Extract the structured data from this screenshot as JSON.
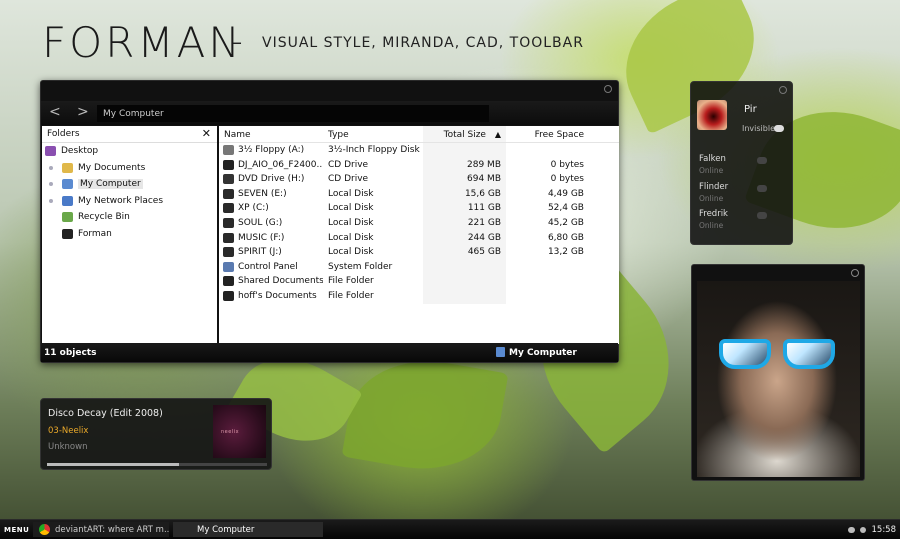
{
  "header": {
    "title": "FORMAN",
    "dash": "–",
    "subtitle": "VISUAL STYLE, MIRANDA, CAD, TOOLBAR"
  },
  "explorer": {
    "back_icon": "<",
    "forward_icon": ">",
    "address": "My Computer",
    "folders_title": "Folders",
    "close_glyph": "✕",
    "tree": [
      {
        "label": "Desktop",
        "icon": "desktop-icon",
        "color": "#8a4fb0"
      },
      {
        "label": "My Documents",
        "icon": "folder-documents-icon",
        "color": "#e0b84a"
      },
      {
        "label": "My Computer",
        "icon": "computer-icon",
        "color": "#5a8ad0"
      },
      {
        "label": "My Network Places",
        "icon": "network-icon",
        "color": "#4a7ac8"
      },
      {
        "label": "Recycle Bin",
        "icon": "recycle-bin-icon",
        "color": "#6aa84a"
      },
      {
        "label": "Forman",
        "icon": "folder-icon",
        "color": "#222222"
      }
    ],
    "columns": {
      "name": "Name",
      "type": "Type",
      "size": "Total Size",
      "free": "Free Space",
      "sort_glyph": "▲"
    },
    "files": [
      {
        "name": "3½ Floppy (A:)",
        "type": "3½-Inch Floppy Disk",
        "size": "",
        "free": "",
        "icon": "floppy-icon",
        "color": "#777777"
      },
      {
        "name": "DJ_AIO_06_F2400...",
        "type": "CD Drive",
        "size": "289 MB",
        "free": "0 bytes",
        "icon": "hp-cd-icon",
        "color": "#222222"
      },
      {
        "name": "DVD Drive (H:)",
        "type": "CD Drive",
        "size": "694 MB",
        "free": "0 bytes",
        "icon": "dvd-drive-icon",
        "color": "#333333"
      },
      {
        "name": "SEVEN (E:)",
        "type": "Local Disk",
        "size": "15,6 GB",
        "free": "4,49 GB",
        "icon": "disk-icon",
        "color": "#2a2a2a"
      },
      {
        "name": "XP (C:)",
        "type": "Local Disk",
        "size": "111 GB",
        "free": "52,4 GB",
        "icon": "disk-icon",
        "color": "#2a2a2a"
      },
      {
        "name": "SOUL (G:)",
        "type": "Local Disk",
        "size": "221 GB",
        "free": "45,2 GB",
        "icon": "disk-icon",
        "color": "#2a2a2a"
      },
      {
        "name": "MUSIC (F:)",
        "type": "Local Disk",
        "size": "244 GB",
        "free": "6,80 GB",
        "icon": "disk-icon",
        "color": "#2a2a2a"
      },
      {
        "name": "SPIRIT (J:)",
        "type": "Local Disk",
        "size": "465 GB",
        "free": "13,2 GB",
        "icon": "disk-icon",
        "color": "#2a2a2a"
      },
      {
        "name": "Control Panel",
        "type": "System Folder",
        "size": "",
        "free": "",
        "icon": "control-panel-icon",
        "color": "#5a7ab0"
      },
      {
        "name": "Shared Documents",
        "type": "File Folder",
        "size": "",
        "free": "",
        "icon": "folder-icon",
        "color": "#222222"
      },
      {
        "name": "hoff's Documents",
        "type": "File Folder",
        "size": "",
        "free": "",
        "icon": "folder-icon",
        "color": "#222222"
      }
    ],
    "status_left": "11 objects",
    "status_right": "My Computer"
  },
  "miranda": {
    "user": "Pir",
    "status": "Invisible",
    "contacts": [
      {
        "name": "Falken",
        "status": "Online"
      },
      {
        "name": "Flinder",
        "status": "Online"
      },
      {
        "name": "Fredrik",
        "status": "Online"
      }
    ]
  },
  "player": {
    "title": "Disco Decay (Edit 2008)",
    "artist": "03-Neelix",
    "album": "Unknown",
    "cover_text": "neelix",
    "progress": 0.6
  },
  "taskbar": {
    "menu": "MENU",
    "tasks": [
      {
        "label": "deviantART: where ART m...",
        "icon": "chrome-icon",
        "active": false
      },
      {
        "label": "My Computer",
        "icon": "computer-icon",
        "active": true
      }
    ],
    "clock": "15:58"
  },
  "colors": {
    "accent_orange": "#e9a92a",
    "sunglasses_blue": "#1fa8e6"
  }
}
